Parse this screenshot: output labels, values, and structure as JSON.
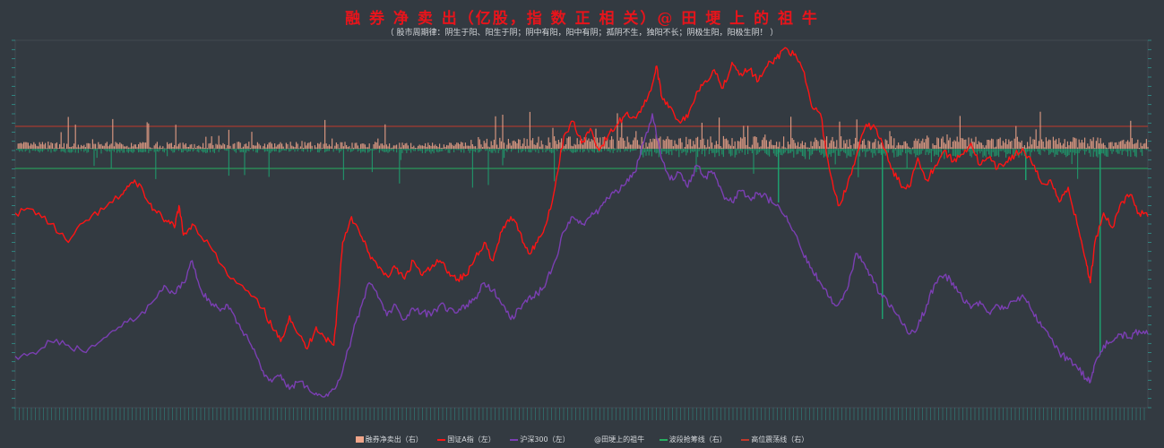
{
  "chart_data": {
    "type": "line",
    "title": "融 券 净 卖 出（亿股，指 数 正 相 关）@ 田 埂 上 的 祖 牛",
    "subtitle": "（ 股市周期律：阴生于阳、阳生于阴；阴中有阳，阳中有阴；孤阴不生，独阳不长；阴极生阳，阳极生阴！ ）",
    "axes": {
      "left": {
        "label": "",
        "range": "unreadable"
      },
      "right": {
        "label": "",
        "range": "unreadable"
      },
      "x": {
        "label": "",
        "ticks": "unreadable dates"
      }
    },
    "reference_lines": [
      {
        "name": "高位震荡线（右）",
        "level_right_axis": "upper",
        "color": "#c0392b"
      },
      {
        "name": "波段抢筹线（右）",
        "level_right_axis": "lower",
        "color": "#27ae60"
      }
    ],
    "series_shape_note": "approximate normalized levels (0 = chart bottom, 1 = chart top) read from the picture; actual axis values are not legible",
    "series": [
      {
        "name": "国证A指（左）",
        "axis": "left",
        "color": "#ff1414",
        "normalized_path": [
          [
            0,
            0.53
          ],
          [
            0.02,
            0.54
          ],
          [
            0.04,
            0.5
          ],
          [
            0.06,
            0.45
          ],
          [
            0.08,
            0.51
          ],
          [
            0.1,
            0.54
          ],
          [
            0.12,
            0.58
          ],
          [
            0.13,
            0.61
          ],
          [
            0.14,
            0.61
          ],
          [
            0.15,
            0.56
          ],
          [
            0.16,
            0.53
          ],
          [
            0.17,
            0.51
          ],
          [
            0.18,
            0.49
          ],
          [
            0.185,
            0.55
          ],
          [
            0.19,
            0.47
          ],
          [
            0.2,
            0.5
          ],
          [
            0.22,
            0.44
          ],
          [
            0.24,
            0.36
          ],
          [
            0.26,
            0.32
          ],
          [
            0.28,
            0.27
          ],
          [
            0.29,
            0.22
          ],
          [
            0.3,
            0.18
          ],
          [
            0.31,
            0.25
          ],
          [
            0.32,
            0.2
          ],
          [
            0.33,
            0.16
          ],
          [
            0.34,
            0.22
          ],
          [
            0.35,
            0.19
          ],
          [
            0.36,
            0.17
          ],
          [
            0.365,
            0.3
          ],
          [
            0.37,
            0.45
          ],
          [
            0.38,
            0.52
          ],
          [
            0.39,
            0.47
          ],
          [
            0.4,
            0.42
          ],
          [
            0.41,
            0.38
          ],
          [
            0.42,
            0.36
          ],
          [
            0.43,
            0.38
          ],
          [
            0.44,
            0.35
          ],
          [
            0.45,
            0.4
          ],
          [
            0.46,
            0.36
          ],
          [
            0.47,
            0.38
          ],
          [
            0.48,
            0.4
          ],
          [
            0.49,
            0.37
          ],
          [
            0.5,
            0.35
          ],
          [
            0.51,
            0.36
          ],
          [
            0.52,
            0.41
          ],
          [
            0.53,
            0.45
          ],
          [
            0.54,
            0.4
          ],
          [
            0.55,
            0.48
          ],
          [
            0.56,
            0.52
          ],
          [
            0.57,
            0.48
          ],
          [
            0.58,
            0.42
          ],
          [
            0.59,
            0.45
          ],
          [
            0.6,
            0.5
          ],
          [
            0.61,
            0.6
          ],
          [
            0.62,
            0.74
          ],
          [
            0.63,
            0.78
          ],
          [
            0.64,
            0.72
          ],
          [
            0.65,
            0.76
          ],
          [
            0.66,
            0.7
          ],
          [
            0.67,
            0.74
          ],
          [
            0.68,
            0.77
          ],
          [
            0.69,
            0.8
          ],
          [
            0.7,
            0.79
          ],
          [
            0.71,
            0.82
          ],
          [
            0.72,
            0.88
          ],
          [
            0.725,
            0.93
          ],
          [
            0.73,
            0.85
          ],
          [
            0.74,
            0.82
          ],
          [
            0.75,
            0.78
          ],
          [
            0.76,
            0.79
          ],
          [
            0.77,
            0.86
          ],
          [
            0.78,
            0.89
          ],
          [
            0.79,
            0.92
          ],
          [
            0.8,
            0.87
          ],
          [
            0.81,
            0.94
          ],
          [
            0.82,
            0.91
          ],
          [
            0.83,
            0.92
          ],
          [
            0.84,
            0.89
          ],
          [
            0.85,
            0.93
          ],
          [
            0.86,
            0.95
          ],
          [
            0.87,
            0.98
          ],
          [
            0.88,
            0.96
          ],
          [
            0.89,
            0.92
          ],
          [
            0.9,
            0.82
          ],
          [
            0.91,
            0.8
          ],
          [
            0.92,
            0.65
          ],
          [
            0.93,
            0.55
          ],
          [
            0.94,
            0.6
          ],
          [
            0.95,
            0.68
          ],
          [
            0.96,
            0.76
          ],
          [
            0.97,
            0.77
          ],
          [
            0.98,
            0.72
          ],
          [
            0.99,
            0.65
          ],
          [
            1.0,
            0.61
          ],
          [
            1.01,
            0.6
          ],
          [
            1.02,
            0.68
          ],
          [
            1.03,
            0.62
          ],
          [
            1.04,
            0.66
          ],
          [
            1.05,
            0.7
          ],
          [
            1.06,
            0.67
          ],
          [
            1.07,
            0.69
          ],
          [
            1.08,
            0.72
          ],
          [
            1.09,
            0.66
          ],
          [
            1.1,
            0.68
          ],
          [
            1.11,
            0.65
          ],
          [
            1.12,
            0.67
          ],
          [
            1.13,
            0.69
          ],
          [
            1.14,
            0.7
          ],
          [
            1.15,
            0.66
          ],
          [
            1.16,
            0.61
          ],
          [
            1.17,
            0.62
          ],
          [
            1.18,
            0.56
          ],
          [
            1.19,
            0.6
          ],
          [
            1.2,
            0.5
          ],
          [
            1.21,
            0.4
          ],
          [
            1.215,
            0.34
          ],
          [
            1.22,
            0.45
          ],
          [
            1.23,
            0.53
          ],
          [
            1.24,
            0.49
          ],
          [
            1.25,
            0.56
          ],
          [
            1.26,
            0.58
          ],
          [
            1.27,
            0.53
          ],
          [
            1.28,
            0.52
          ]
        ]
      },
      {
        "name": "沪深300（左）",
        "axis": "left",
        "color": "#7b3fb3",
        "normalized_path": [
          [
            0,
            0.14
          ],
          [
            0.02,
            0.15
          ],
          [
            0.04,
            0.18
          ],
          [
            0.06,
            0.17
          ],
          [
            0.08,
            0.15
          ],
          [
            0.1,
            0.19
          ],
          [
            0.12,
            0.22
          ],
          [
            0.14,
            0.25
          ],
          [
            0.16,
            0.3
          ],
          [
            0.17,
            0.33
          ],
          [
            0.18,
            0.31
          ],
          [
            0.19,
            0.34
          ],
          [
            0.2,
            0.4
          ],
          [
            0.21,
            0.32
          ],
          [
            0.22,
            0.29
          ],
          [
            0.23,
            0.27
          ],
          [
            0.24,
            0.28
          ],
          [
            0.25,
            0.23
          ],
          [
            0.26,
            0.2
          ],
          [
            0.27,
            0.16
          ],
          [
            0.28,
            0.1
          ],
          [
            0.29,
            0.07
          ],
          [
            0.3,
            0.09
          ],
          [
            0.31,
            0.05
          ],
          [
            0.32,
            0.07
          ],
          [
            0.33,
            0.06
          ],
          [
            0.34,
            0.04
          ],
          [
            0.35,
            0.03
          ],
          [
            0.36,
            0.05
          ],
          [
            0.37,
            0.1
          ],
          [
            0.38,
            0.19
          ],
          [
            0.39,
            0.27
          ],
          [
            0.4,
            0.34
          ],
          [
            0.41,
            0.3
          ],
          [
            0.42,
            0.25
          ],
          [
            0.43,
            0.28
          ],
          [
            0.44,
            0.24
          ],
          [
            0.45,
            0.27
          ],
          [
            0.46,
            0.26
          ],
          [
            0.47,
            0.25
          ],
          [
            0.48,
            0.28
          ],
          [
            0.49,
            0.27
          ],
          [
            0.5,
            0.26
          ],
          [
            0.51,
            0.28
          ],
          [
            0.52,
            0.3
          ],
          [
            0.53,
            0.34
          ],
          [
            0.54,
            0.32
          ],
          [
            0.55,
            0.28
          ],
          [
            0.56,
            0.24
          ],
          [
            0.57,
            0.27
          ],
          [
            0.58,
            0.3
          ],
          [
            0.59,
            0.31
          ],
          [
            0.6,
            0.34
          ],
          [
            0.61,
            0.4
          ],
          [
            0.62,
            0.48
          ],
          [
            0.63,
            0.52
          ],
          [
            0.64,
            0.5
          ],
          [
            0.65,
            0.52
          ],
          [
            0.66,
            0.54
          ],
          [
            0.67,
            0.57
          ],
          [
            0.68,
            0.59
          ],
          [
            0.69,
            0.61
          ],
          [
            0.7,
            0.64
          ],
          [
            0.71,
            0.72
          ],
          [
            0.72,
            0.8
          ],
          [
            0.73,
            0.68
          ],
          [
            0.74,
            0.62
          ],
          [
            0.75,
            0.64
          ],
          [
            0.76,
            0.6
          ],
          [
            0.77,
            0.66
          ],
          [
            0.78,
            0.63
          ],
          [
            0.79,
            0.64
          ],
          [
            0.8,
            0.58
          ],
          [
            0.81,
            0.56
          ],
          [
            0.82,
            0.59
          ],
          [
            0.83,
            0.57
          ],
          [
            0.84,
            0.58
          ],
          [
            0.85,
            0.57
          ],
          [
            0.86,
            0.55
          ],
          [
            0.87,
            0.52
          ],
          [
            0.88,
            0.48
          ],
          [
            0.89,
            0.42
          ],
          [
            0.9,
            0.38
          ],
          [
            0.91,
            0.34
          ],
          [
            0.92,
            0.3
          ],
          [
            0.93,
            0.28
          ],
          [
            0.94,
            0.32
          ],
          [
            0.95,
            0.42
          ],
          [
            0.96,
            0.39
          ],
          [
            0.97,
            0.34
          ],
          [
            0.98,
            0.3
          ],
          [
            0.99,
            0.28
          ],
          [
            1.0,
            0.24
          ],
          [
            1.01,
            0.2
          ],
          [
            1.02,
            0.22
          ],
          [
            1.03,
            0.28
          ],
          [
            1.04,
            0.34
          ],
          [
            1.05,
            0.36
          ],
          [
            1.06,
            0.34
          ],
          [
            1.07,
            0.3
          ],
          [
            1.08,
            0.27
          ],
          [
            1.09,
            0.29
          ],
          [
            1.1,
            0.26
          ],
          [
            1.11,
            0.28
          ],
          [
            1.12,
            0.27
          ],
          [
            1.13,
            0.29
          ],
          [
            1.14,
            0.3
          ],
          [
            1.15,
            0.26
          ],
          [
            1.16,
            0.22
          ],
          [
            1.17,
            0.19
          ],
          [
            1.18,
            0.15
          ],
          [
            1.19,
            0.13
          ],
          [
            1.2,
            0.11
          ],
          [
            1.21,
            0.08
          ],
          [
            1.215,
            0.07
          ],
          [
            1.22,
            0.12
          ],
          [
            1.23,
            0.17
          ],
          [
            1.24,
            0.18
          ],
          [
            1.25,
            0.2
          ],
          [
            1.26,
            0.19
          ],
          [
            1.27,
            0.21
          ],
          [
            1.28,
            0.2
          ]
        ]
      },
      {
        "name": "融券净卖出（右）",
        "axis": "right",
        "color_positive": "#f0a58a",
        "color_negative": "#1e9e6e",
        "type": "bar",
        "note": "dense daily bars around a baseline; values not legible"
      }
    ],
    "legend": {
      "placement": "bottom-center",
      "entries": [
        {
          "label": "融券净卖出（右）",
          "kind": "bar",
          "color": "#f0a58a"
        },
        {
          "label": "国证A指（左）",
          "kind": "line",
          "color": "#ff1414"
        },
        {
          "label": "沪深300（左）",
          "kind": "line",
          "color": "#7b3fb3"
        },
        {
          "label": "@田埂上的祖牛",
          "kind": "line",
          "color": "#333a41"
        },
        {
          "label": "波段抢筹线（右）",
          "kind": "line",
          "color": "#27ae60"
        },
        {
          "label": "高位震荡线（右）",
          "kind": "line",
          "color": "#c0392b"
        }
      ]
    },
    "grid": false,
    "colors": {
      "background": "#333a41",
      "title": "#e8141b",
      "axis_tick": "#2fb5a8"
    }
  }
}
